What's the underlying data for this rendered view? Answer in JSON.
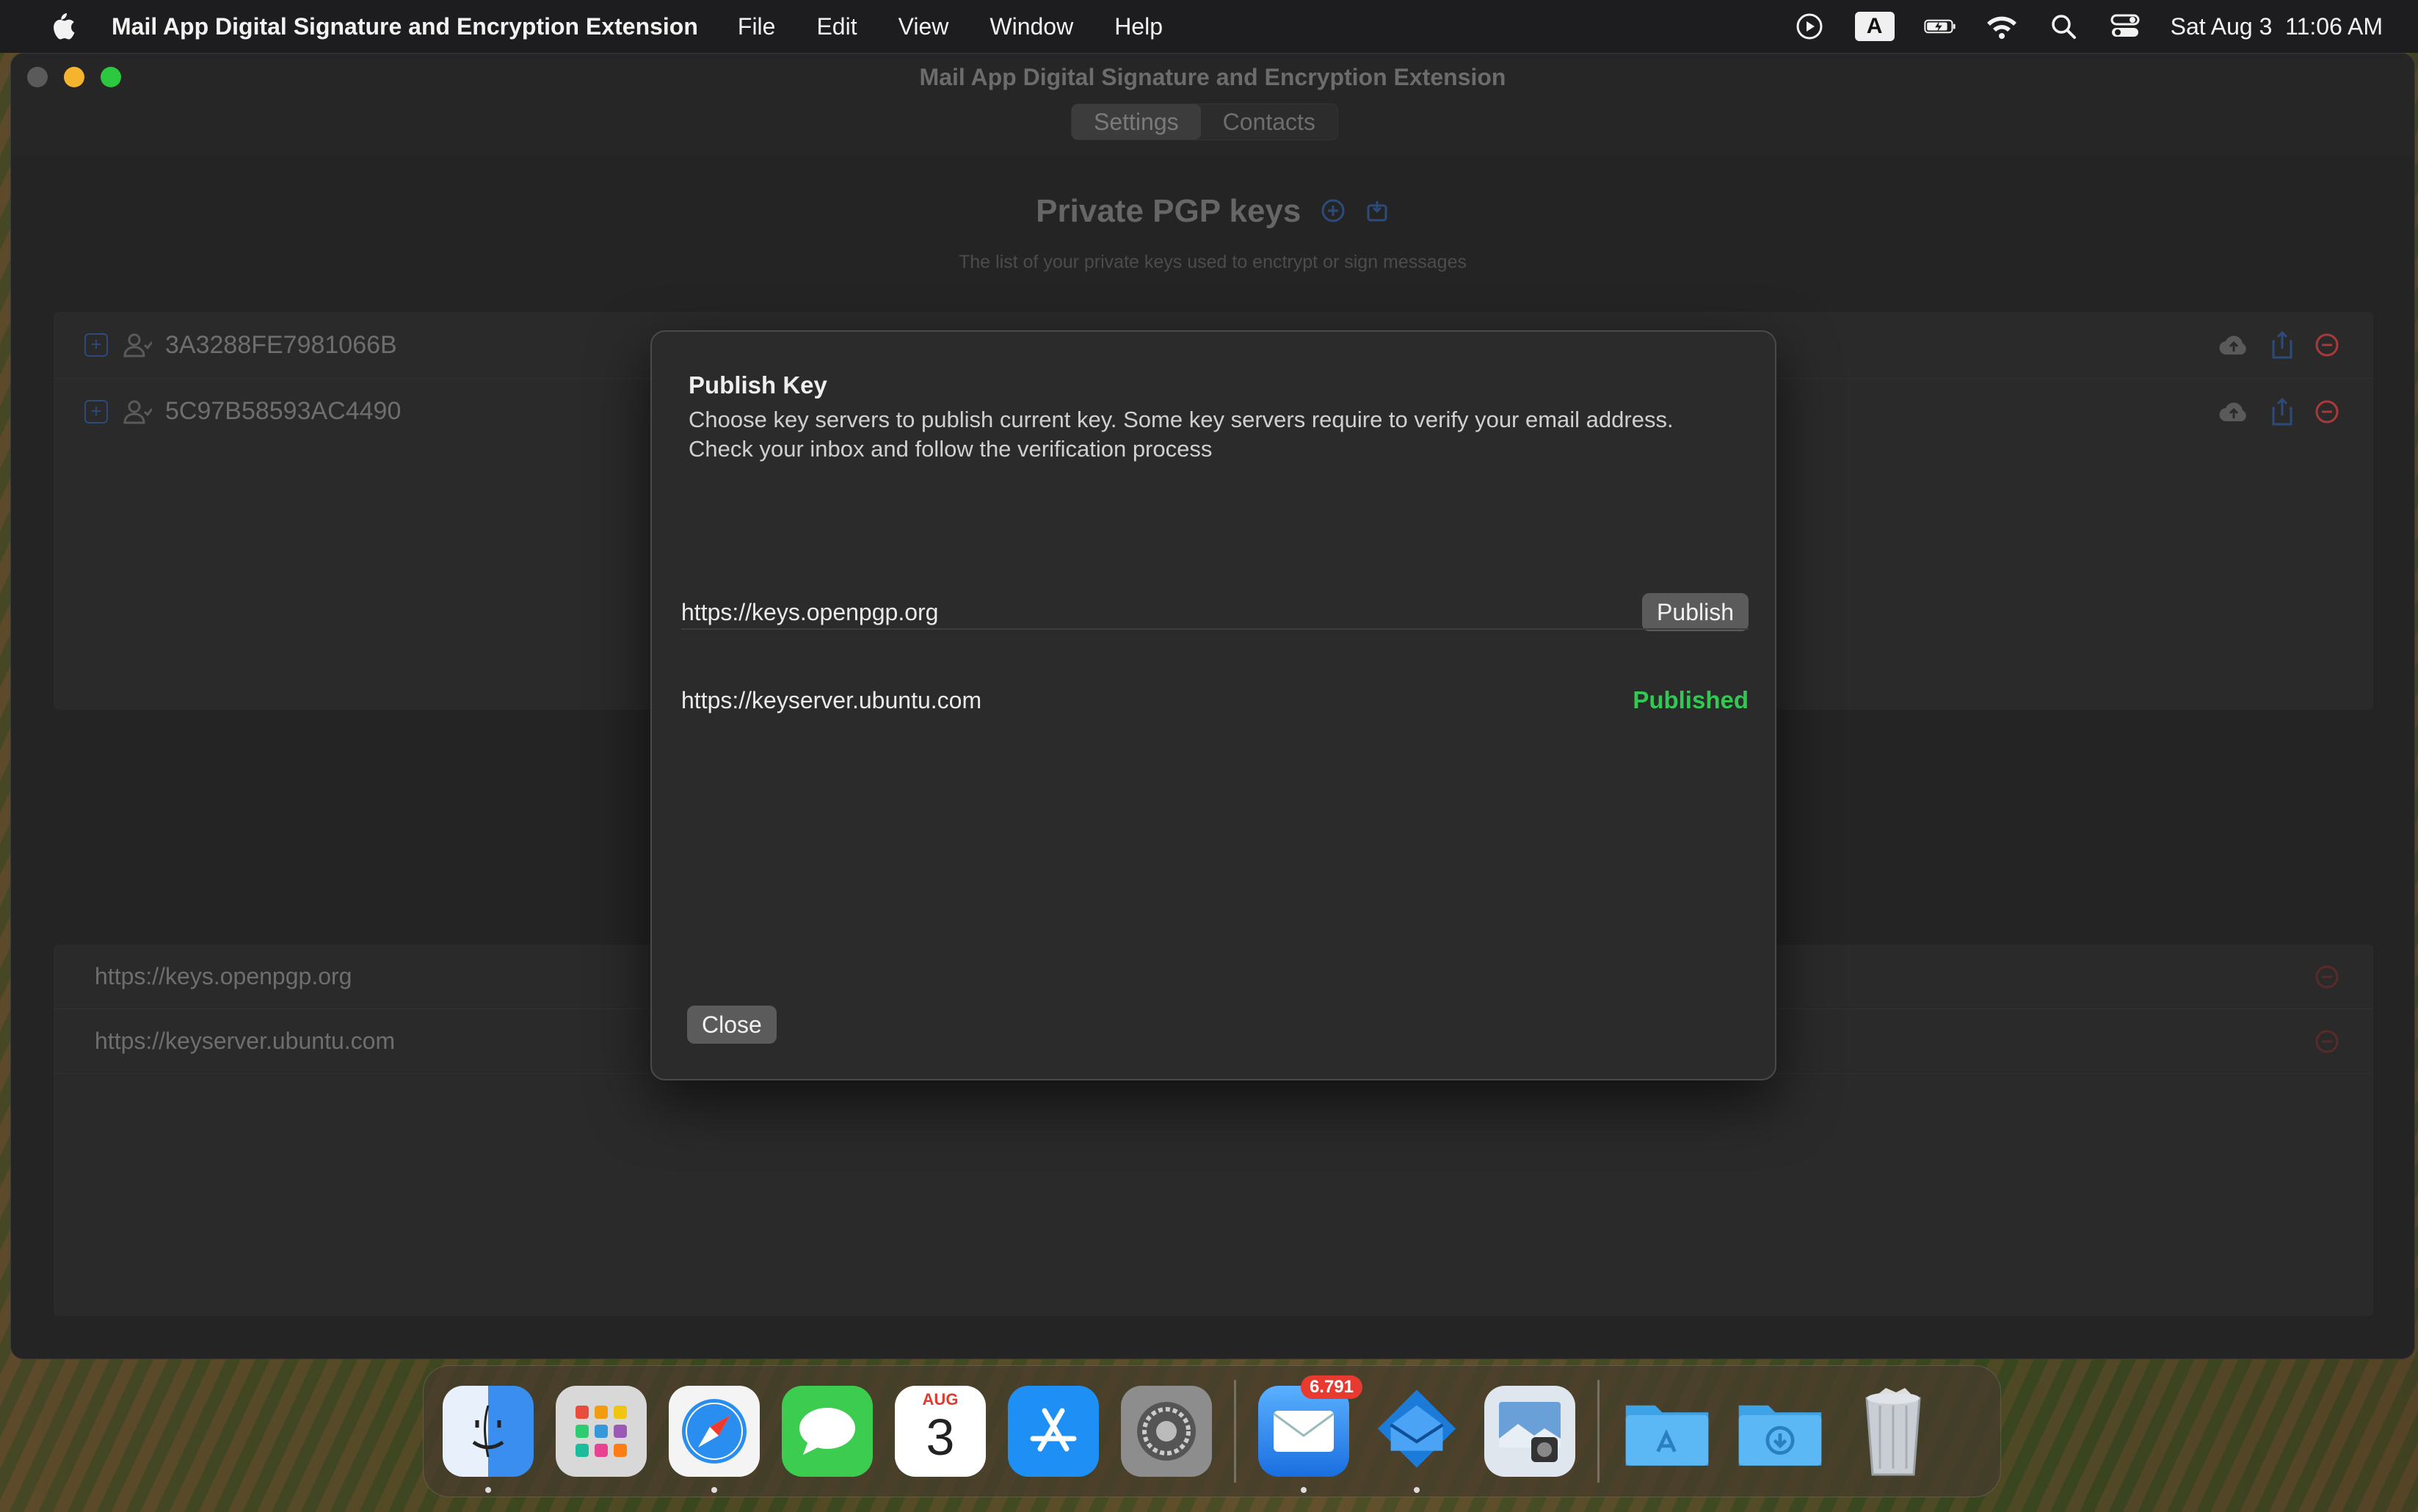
{
  "menubar": {
    "app_name": "Mail App Digital Signature and Encryption Extension",
    "items": [
      "File",
      "Edit",
      "View",
      "Window",
      "Help"
    ],
    "input_indicator": "A",
    "datetime": "Sat Aug 3  11:06 AM"
  },
  "window": {
    "title": "Mail App Digital Signature and Encryption Extension",
    "tabs": [
      "Settings",
      "Contacts"
    ],
    "active_tab": "Settings",
    "section_title": "Private PGP keys",
    "section_subtitle": "The list of your private keys used to enctrypt or sign messages",
    "keys": [
      {
        "id": "3A3288FE7981066B"
      },
      {
        "id": "5C97B58593AC4490"
      }
    ],
    "key_servers": [
      "https://keys.openpgp.org",
      "https://keyserver.ubuntu.com"
    ]
  },
  "dialog": {
    "title": "Publish Key",
    "description": "Choose key servers to publish current key. Some key servers require to verify your email address. Check your inbox and follow the verification process",
    "servers": [
      {
        "url": "https://keys.openpgp.org",
        "action_label": "Publish"
      },
      {
        "url": "https://keyserver.ubuntu.com",
        "status_label": "Published"
      }
    ],
    "close_label": "Close"
  },
  "dock": {
    "mail_badge": "6.791",
    "calendar_month": "AUG",
    "calendar_day": "3",
    "apps": [
      "finder-icon",
      "launchpad-icon",
      "safari-icon",
      "messages-icon",
      "calendar-icon",
      "app-store-icon",
      "system-settings-icon",
      "mail-icon",
      "mail-extension-icon",
      "preview-icon",
      "applications-folder-icon",
      "downloads-folder-icon",
      "trash-icon"
    ]
  },
  "colors": {
    "published": "#32c852",
    "accent_blue": "#2d4b7a",
    "danger_red": "#a83a3a"
  }
}
